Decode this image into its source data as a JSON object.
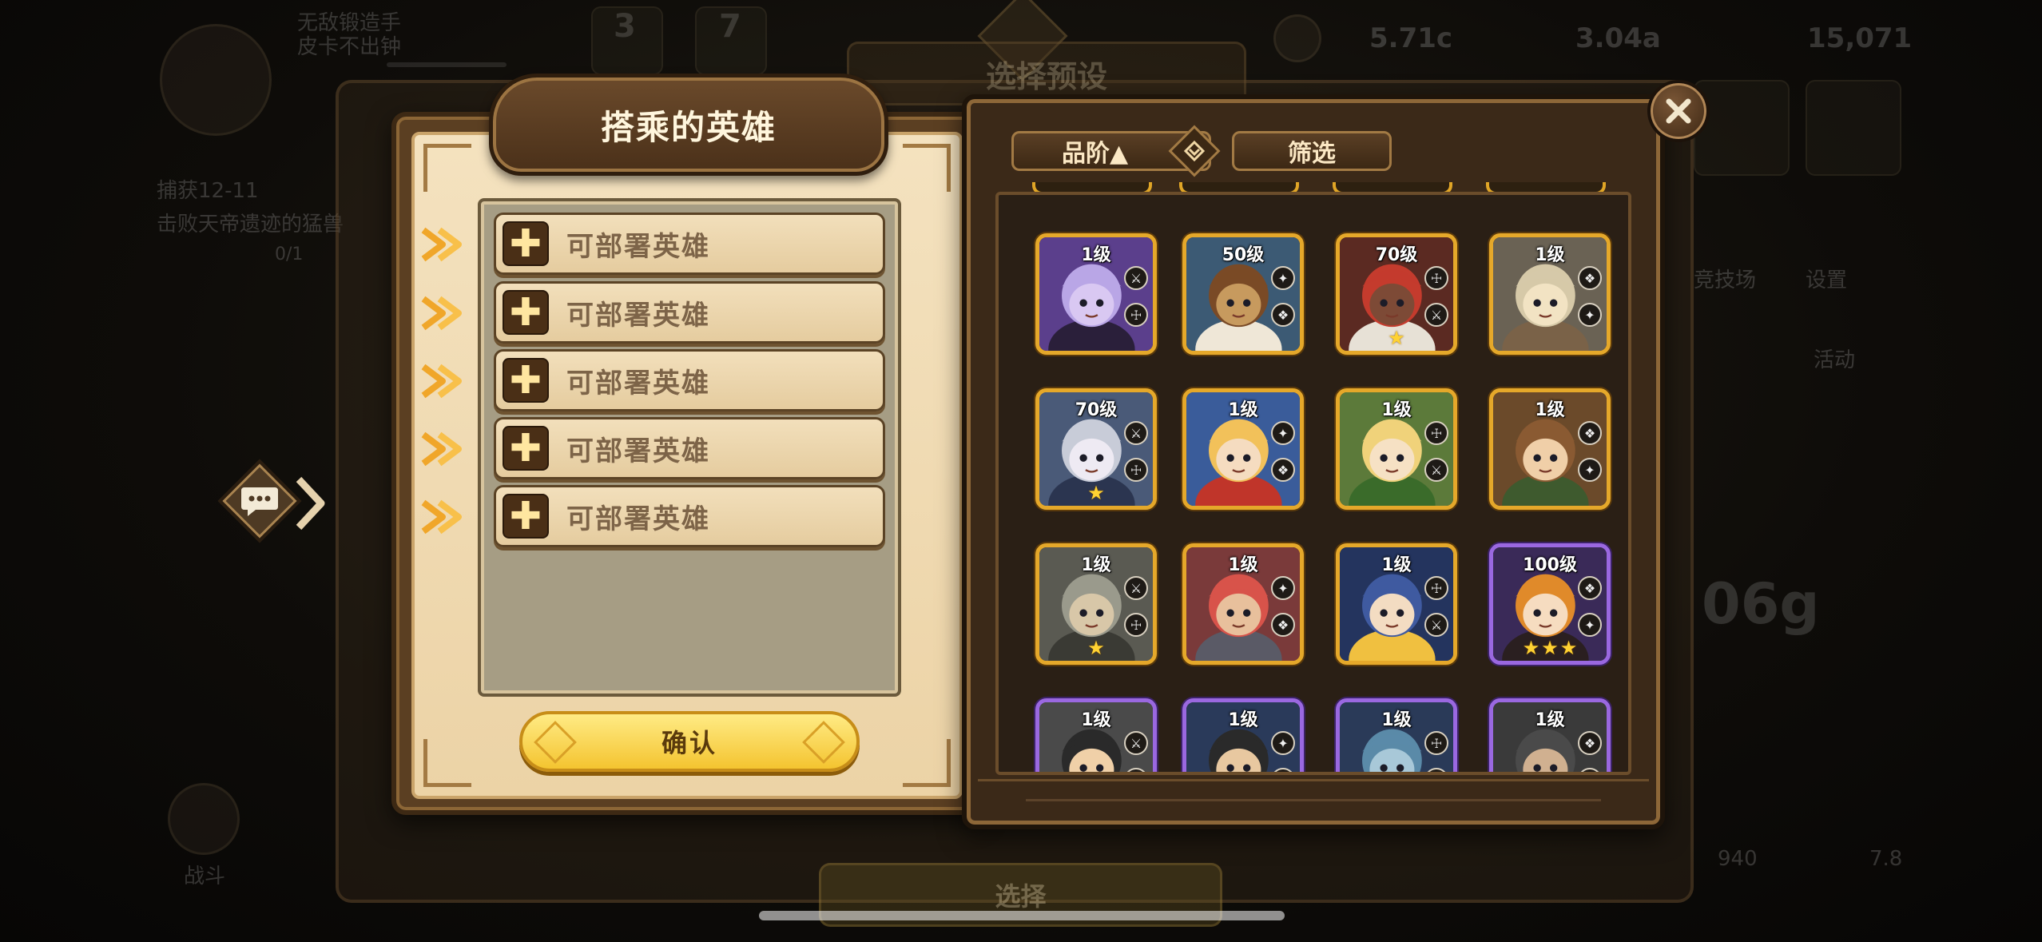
{
  "background": {
    "top_left_text_1": "无敌锻造手",
    "top_left_text_2": "皮卡不出钟",
    "mission_text": "捕获12-11",
    "mission_desc": "击败天帝遗迹的猛兽",
    "mission_progress": "0/1",
    "currency_1": "5.71c",
    "currency_2": "3.04a",
    "currency_3": "15,071",
    "badge_1": "3",
    "badge_2": "7",
    "big_value": "06g",
    "bottom_left_label": "战斗",
    "bottom_right_value": "7.8",
    "bottom_value_2": "940",
    "side_label_1": "活动",
    "side_label_2": "设置",
    "side_label_3": "竞技场",
    "preset_title": "选择预设",
    "select_button": "选择"
  },
  "left_panel": {
    "title": "搭乘的英雄",
    "slots": [
      {
        "label": "可部署英雄"
      },
      {
        "label": "可部署英雄"
      },
      {
        "label": "可部署英雄"
      },
      {
        "label": "可部署英雄"
      },
      {
        "label": "可部署英雄"
      }
    ],
    "confirm_label": "确认"
  },
  "right_panel": {
    "sort_label": "品阶▲",
    "filter_label": "筛选",
    "heroes": [
      {
        "level": "1级",
        "rarity": "gold",
        "stars": 0,
        "palette": "purple-witch"
      },
      {
        "level": "50级",
        "rarity": "gold",
        "stars": 0,
        "palette": "tan-warrior"
      },
      {
        "level": "70级",
        "rarity": "gold",
        "stars": 1,
        "palette": "red-demon"
      },
      {
        "level": "1级",
        "rarity": "gold",
        "stars": 0,
        "palette": "grey-viking"
      },
      {
        "level": "70级",
        "rarity": "gold",
        "stars": 1,
        "palette": "silver-girl"
      },
      {
        "level": "1级",
        "rarity": "gold",
        "stars": 0,
        "palette": "blonde-prince"
      },
      {
        "level": "1级",
        "rarity": "gold",
        "stars": 0,
        "palette": "elf-braid"
      },
      {
        "level": "1级",
        "rarity": "gold",
        "stars": 0,
        "palette": "brown-ranger"
      },
      {
        "level": "1级",
        "rarity": "gold",
        "stars": 1,
        "palette": "dwarf-horn"
      },
      {
        "level": "1级",
        "rarity": "gold",
        "stars": 0,
        "palette": "red-brawler"
      },
      {
        "level": "1级",
        "rarity": "gold",
        "stars": 0,
        "palette": "blue-horn"
      },
      {
        "level": "100级",
        "rarity": "purple",
        "stars": 3,
        "palette": "orange-witch"
      },
      {
        "level": "1级",
        "rarity": "purple",
        "stars": 0,
        "palette": "cap-boy"
      },
      {
        "level": "1级",
        "rarity": "purple",
        "stars": 0,
        "palette": "warpaint"
      },
      {
        "level": "1级",
        "rarity": "purple",
        "stars": 0,
        "palette": "robot"
      },
      {
        "level": "1级",
        "rarity": "purple",
        "stars": 0,
        "palette": "dark-hat"
      }
    ]
  },
  "colors": {
    "gold_frame": "#e5a82a",
    "purple_frame": "#9a68e0",
    "parchment": "#f4e2bf",
    "confirm_yellow": "#f4c430"
  }
}
